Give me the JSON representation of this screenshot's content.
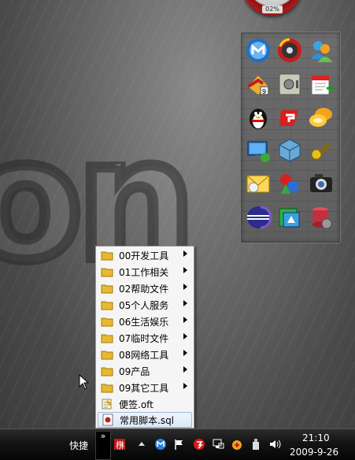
{
  "desktop": {
    "gauge_value": "02%",
    "dock_icons": [
      "maxthon-browser-icon",
      "disk-tool-icon",
      "msn-messenger-icon",
      "office-suite-icon",
      "safe-vault-icon",
      "calendar-notes-icon",
      "qq-penguin-icon",
      "foxit-reader-icon",
      "chat-bubbles-icon",
      "remote-desktop-icon",
      "virtualbox-icon",
      "key-tool-icon",
      "outlook-icon",
      "shapes-tool-icon",
      "camera-icon",
      "eclipse-icon",
      "screen-capture-icon",
      "database-icon"
    ]
  },
  "menu": {
    "items": [
      {
        "label": "00开发工具",
        "icon": "folder-icon",
        "submenu": true
      },
      {
        "label": "01工作相关",
        "icon": "folder-icon",
        "submenu": true
      },
      {
        "label": "02帮助文件",
        "icon": "folder-icon",
        "submenu": true
      },
      {
        "label": "05个人服务",
        "icon": "folder-icon",
        "submenu": true
      },
      {
        "label": "06生活娱乐",
        "icon": "folder-icon",
        "submenu": true
      },
      {
        "label": "07临时文件",
        "icon": "folder-icon",
        "submenu": true
      },
      {
        "label": "08网络工具",
        "icon": "folder-icon",
        "submenu": true
      },
      {
        "label": "09产品",
        "icon": "folder-icon",
        "submenu": true
      },
      {
        "label": "09其它工具",
        "icon": "folder-icon",
        "submenu": true
      },
      {
        "label": "便签.oft",
        "icon": "note-icon",
        "submenu": false
      },
      {
        "label": "常用脚本.sql",
        "icon": "sql-file-icon",
        "submenu": false
      }
    ]
  },
  "taskbar": {
    "toolbar_label": "快捷",
    "chevron": "»",
    "clock_time": "21:10",
    "clock_date": "2009-9-26",
    "tray_icons": [
      "input-method-icon",
      "show-hidden-icons-chevron",
      "maxthon-tray-icon",
      "action-center-flag-icon",
      "antivirus-icon",
      "network-icon",
      "bt-download-icon",
      "usb-device-icon",
      "volume-icon"
    ]
  },
  "colors": {
    "menu_bg": "#f5f5f5",
    "taskbar_bg": "#0a0a0a",
    "selected": "#dbe8f7",
    "folder": "#e8b830"
  }
}
